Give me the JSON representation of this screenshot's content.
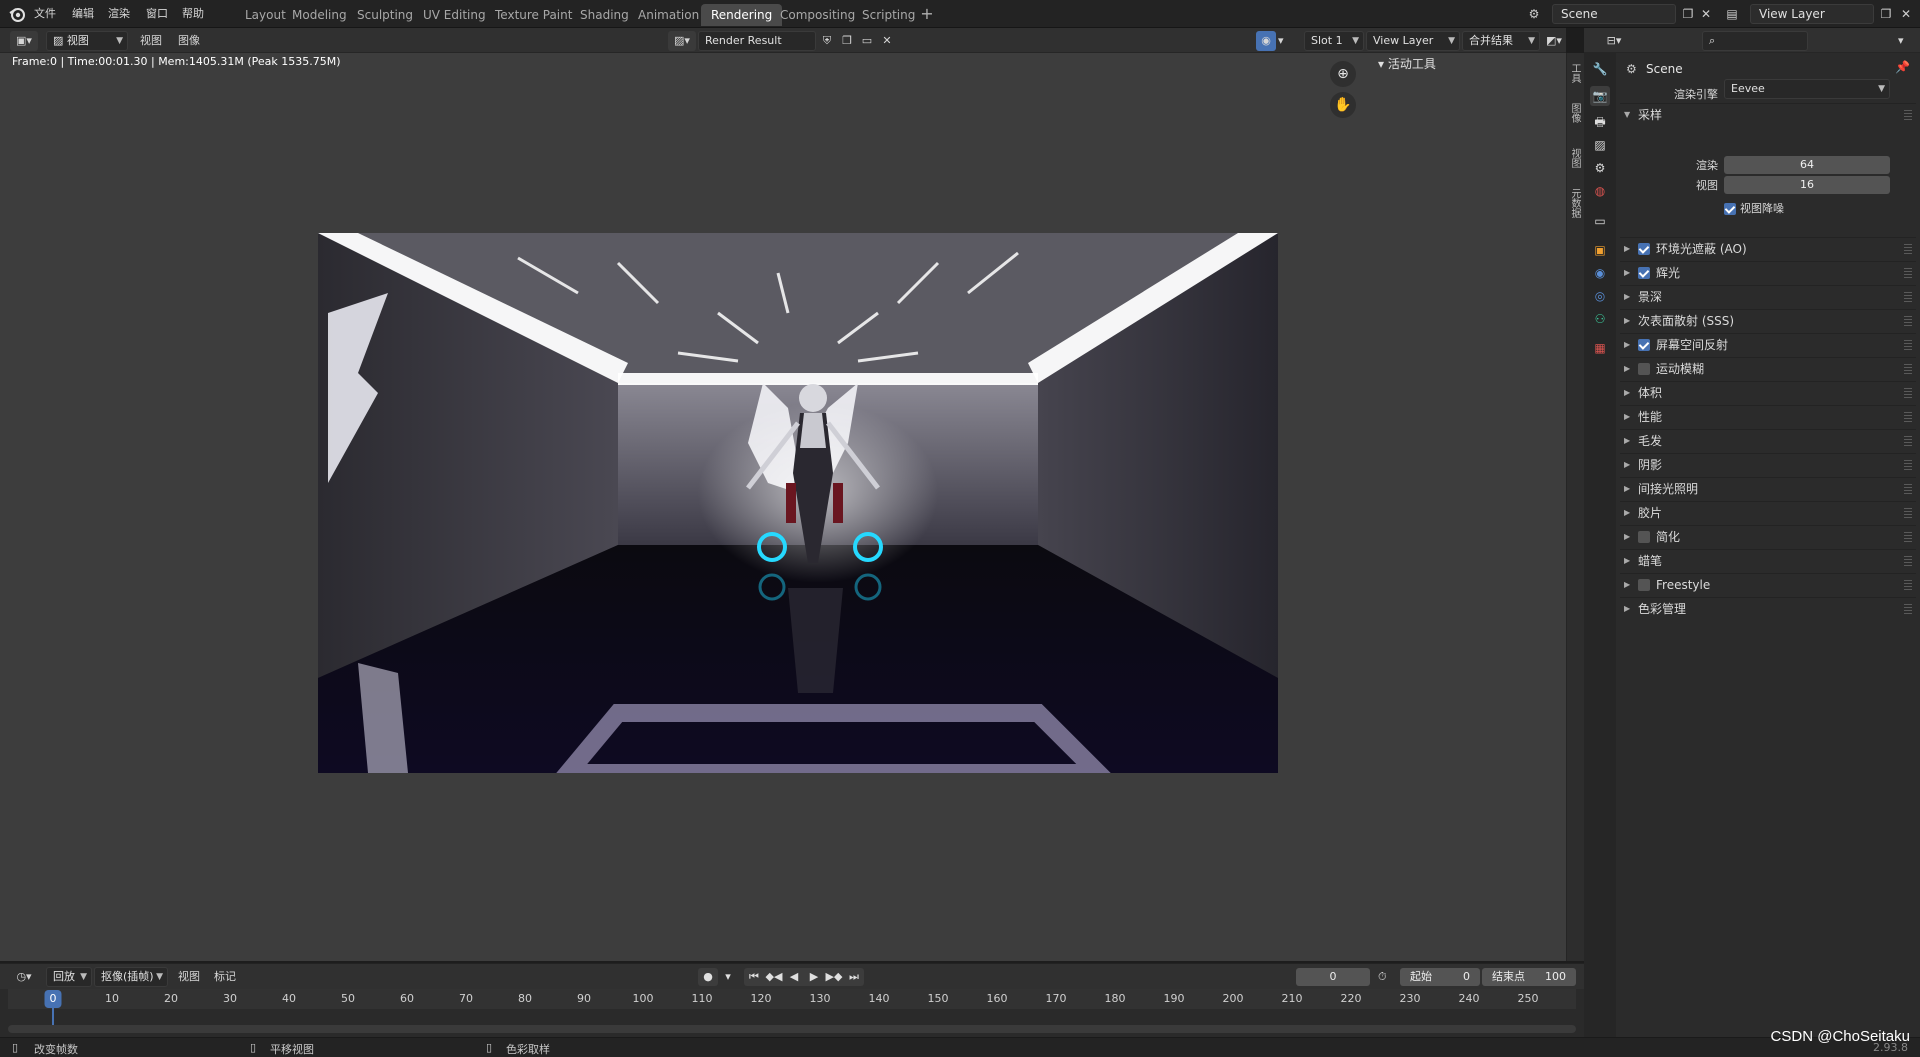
{
  "topbar": {
    "menus": [
      "文件",
      "编辑",
      "渲染",
      "窗口",
      "帮助"
    ],
    "workspaces": [
      {
        "label": "Layout",
        "active": false
      },
      {
        "label": "Modeling",
        "active": false
      },
      {
        "label": "Sculpting",
        "active": false
      },
      {
        "label": "UV Editing",
        "active": false
      },
      {
        "label": "Texture Paint",
        "active": false
      },
      {
        "label": "Shading",
        "active": false
      },
      {
        "label": "Animation",
        "active": false
      },
      {
        "label": "Rendering",
        "active": true
      },
      {
        "label": "Compositing",
        "active": false
      },
      {
        "label": "Scripting",
        "active": false
      }
    ],
    "add_workspace": "+",
    "scene_name": "Scene",
    "view_layer_name": "View Layer"
  },
  "image_editor": {
    "view_mode": "视图",
    "menus": [
      "视图",
      "图像"
    ],
    "image_name": "Render Result",
    "slot": "Slot 1",
    "view_layer": "View Layer",
    "pass": "合并结果",
    "render_info": "Frame:0 | Time:00:01.30 | Mem:1405.31M (Peak 1535.75M)",
    "tool_panel_title": "活动工具",
    "side_tabs": [
      "工具",
      "图像",
      "视图",
      "元数据"
    ]
  },
  "properties": {
    "scene_label": "Scene",
    "render_engine_label": "渲染引擎",
    "render_engine": "Eevee",
    "sampling_title": "采样",
    "render_samples_label": "渲染",
    "render_samples": "64",
    "viewport_samples_label": "视图",
    "viewport_samples": "16",
    "viewport_denoise_label": "视图降噪",
    "viewport_denoise": true,
    "panels": [
      {
        "label": "环境光遮蔽 (AO)",
        "checkbox": true,
        "checked": true
      },
      {
        "label": "辉光",
        "checkbox": true,
        "checked": true
      },
      {
        "label": "景深",
        "checkbox": false,
        "checked": false
      },
      {
        "label": "次表面散射 (SSS)",
        "checkbox": false,
        "checked": false
      },
      {
        "label": "屏幕空间反射",
        "checkbox": true,
        "checked": true
      },
      {
        "label": "运动模糊",
        "checkbox": true,
        "checked": false
      },
      {
        "label": "体积",
        "checkbox": false,
        "checked": false
      },
      {
        "label": "性能",
        "checkbox": false,
        "checked": false
      },
      {
        "label": "毛发",
        "checkbox": false,
        "checked": false
      },
      {
        "label": "阴影",
        "checkbox": false,
        "checked": false
      },
      {
        "label": "间接光照明",
        "checkbox": false,
        "checked": false
      },
      {
        "label": "胶片",
        "checkbox": false,
        "checked": false
      },
      {
        "label": "简化",
        "checkbox": true,
        "checked": false
      },
      {
        "label": "蜡笔",
        "checkbox": false,
        "checked": false
      },
      {
        "label": "Freestyle",
        "checkbox": true,
        "checked": false
      },
      {
        "label": "色彩管理",
        "checkbox": false,
        "checked": false
      }
    ]
  },
  "timeline": {
    "playback": "回放",
    "keying": "抠像(插帧)",
    "view": "视图",
    "marker": "标记",
    "current_frame": "0",
    "start_label": "起始",
    "start": "0",
    "end_label": "结束点",
    "end": "100",
    "ticks": [
      "0",
      "10",
      "20",
      "30",
      "40",
      "50",
      "60",
      "70",
      "80",
      "90",
      "100",
      "110",
      "120",
      "130",
      "140",
      "150",
      "160",
      "170",
      "180",
      "190",
      "200",
      "210",
      "220",
      "230",
      "240",
      "250"
    ]
  },
  "statusbar": {
    "items": [
      "改变帧数",
      "平移视图",
      "色彩取样"
    ],
    "version": "2.93.8"
  },
  "watermark": "CSDN @ChoSeitaku",
  "colors": {
    "accent": "#4772b3",
    "active_tab": "#4a4a4a",
    "viewport_bg": "#3d3d3d"
  }
}
